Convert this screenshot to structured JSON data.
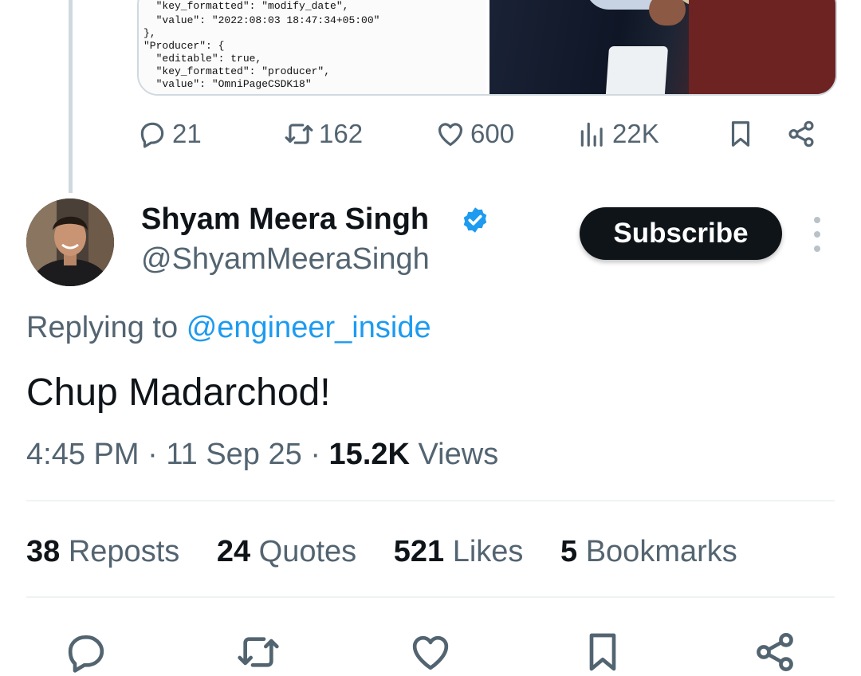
{
  "media": {
    "code_lines": [
      "  \"key_formatted\": \"modify_date\",",
      "  \"value\": \"2022:08:03 18:47:34+05:00\"",
      "},",
      "\"Producer\": {",
      "  \"editable\": true,",
      "  \"key_formatted\": \"producer\",",
      "  \"value\": \"OmniPageCSDK18\""
    ]
  },
  "parent_actions": {
    "replies": "21",
    "reposts": "162",
    "likes": "600",
    "views": "22K"
  },
  "tweet": {
    "display_name": "Shyam Meera Singh",
    "handle": "@ShyamMeeraSingh",
    "subscribe_label": "Subscribe",
    "replying_prefix": "Replying to",
    "replying_to": "@engineer_inside",
    "text": "Chup Madarchod!",
    "time": "4:45 PM",
    "separator": "·",
    "date": "11 Sep 25",
    "views_count": "15.2K",
    "views_label": "Views"
  },
  "stats": {
    "reposts_count": "38",
    "reposts_label": "Reposts",
    "quotes_count": "24",
    "quotes_label": "Quotes",
    "likes_count": "521",
    "likes_label": "Likes",
    "bookmarks_count": "5",
    "bookmarks_label": "Bookmarks"
  },
  "colors": {
    "accent": "#1d9bf0",
    "text_primary": "#0f1419",
    "text_secondary": "#536471",
    "divider": "#eff3f4"
  },
  "icons": [
    "reply-icon",
    "repost-icon",
    "like-icon",
    "views-icon",
    "bookmark-icon",
    "share-icon",
    "verified-badge-icon",
    "more-options-icon"
  ]
}
